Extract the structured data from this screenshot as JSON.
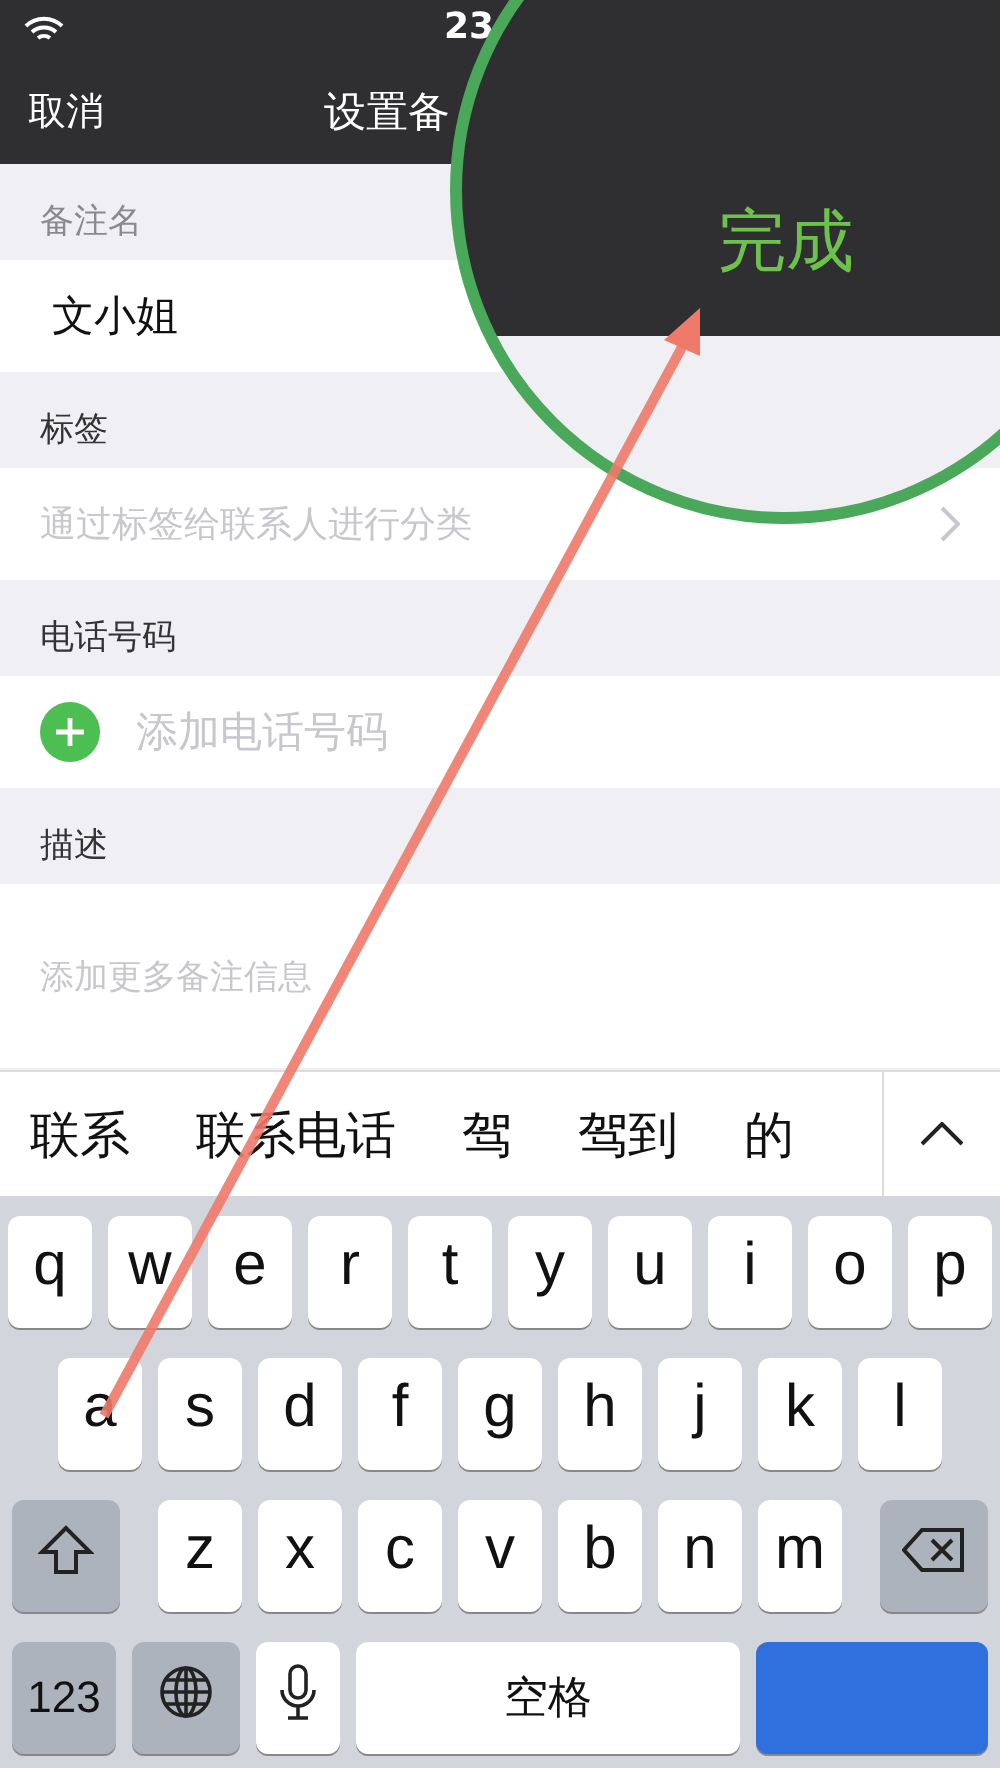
{
  "status_bar": {
    "time": "23"
  },
  "nav": {
    "cancel": "取消",
    "title": "设置备"
  },
  "sections": [
    {
      "kind": "text",
      "label": "备注名",
      "value": "文小姐"
    },
    {
      "kind": "link",
      "label": "标签",
      "placeholder": "通过标签给联系人进行分类"
    },
    {
      "kind": "add",
      "label": "电话号码",
      "placeholder": "添加电话号码"
    },
    {
      "kind": "area",
      "label": "描述",
      "placeholder": "添加更多备注信息"
    }
  ],
  "candidates": [
    "联系",
    "联系电话",
    "驾",
    "驾到",
    "的"
  ],
  "keyboard": {
    "rows": [
      [
        "q",
        "w",
        "e",
        "r",
        "t",
        "y",
        "u",
        "i",
        "o",
        "p"
      ],
      [
        "a",
        "s",
        "d",
        "f",
        "g",
        "h",
        "j",
        "k",
        "l"
      ],
      [
        "z",
        "x",
        "c",
        "v",
        "b",
        "n",
        "m"
      ]
    ],
    "numbers": "123",
    "space": "空格"
  },
  "magnifier": {
    "done": "完成"
  }
}
